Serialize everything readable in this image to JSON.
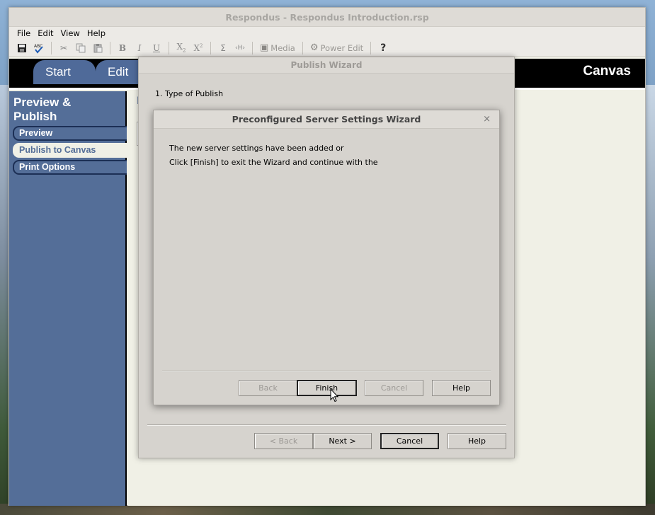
{
  "window": {
    "title": "Respondus - Respondus Introduction.rsp"
  },
  "menu": {
    "file": "File",
    "edit": "Edit",
    "view": "View",
    "help": "Help"
  },
  "toolbar": {
    "media_label": "Media",
    "power_edit_label": "Power Edit",
    "bold": "B",
    "italic": "I",
    "underline": "U",
    "sigma": "Σ",
    "code": "‹H›",
    "help_glyph": "?"
  },
  "tabs": {
    "start": "Start",
    "edit": "Edit"
  },
  "brand": "Canvas",
  "sidebar": {
    "title_line1": "Preview &",
    "title_line2": "Publish",
    "items": [
      {
        "label": "Preview",
        "active": false
      },
      {
        "label": "Publish to Canvas",
        "active": true
      },
      {
        "label": "Print Options",
        "active": false
      }
    ]
  },
  "content": {
    "heading_fragment": "F"
  },
  "publish_wizard": {
    "title": "Publish Wizard",
    "step": "1.  Type of Publish",
    "buttons": {
      "back": "< Back",
      "next": "Next >",
      "cancel": "Cancel",
      "help": "Help"
    }
  },
  "server_dialog": {
    "title": "Preconfigured Server Settings Wizard",
    "close_glyph": "×",
    "line1": "The new server settings have been added or",
    "line2": "Click [Finish] to exit the Wizard and continue with the",
    "buttons": {
      "back": "Back",
      "finish": "Finish",
      "cancel": "Cancel",
      "help": "Help"
    }
  }
}
